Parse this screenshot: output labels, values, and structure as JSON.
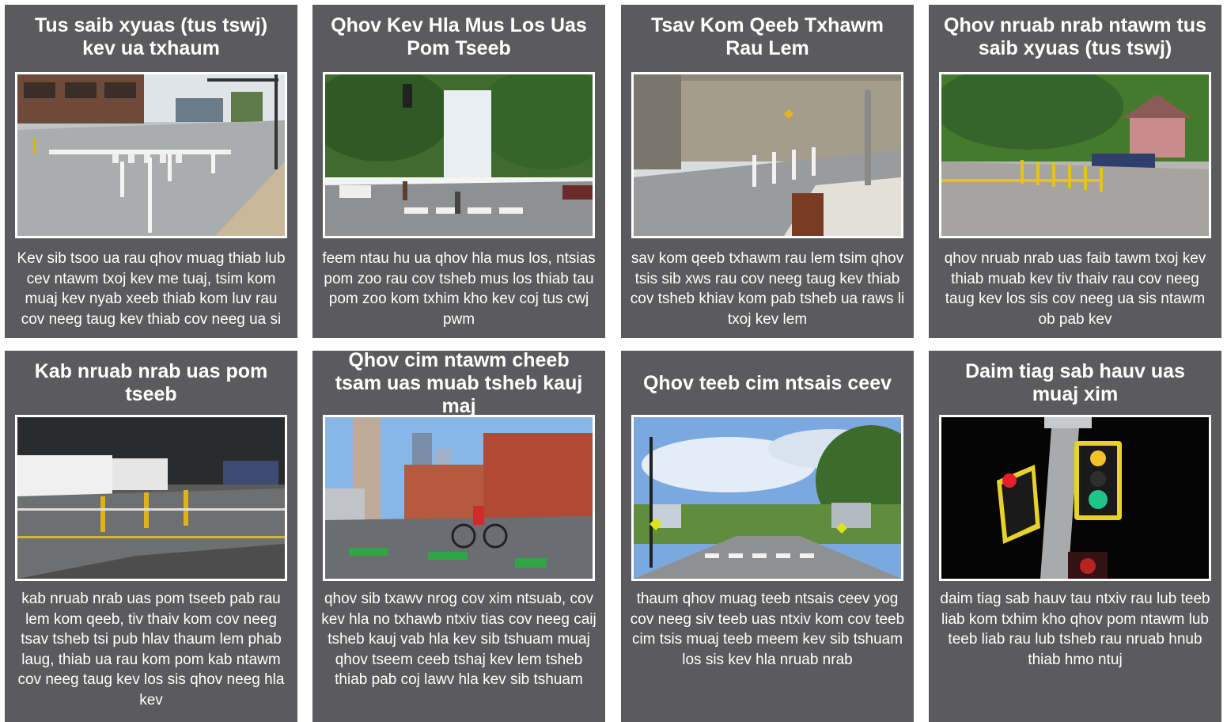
{
  "cards": [
    {
      "title": "Tus saib xyuas (tus tswj) kev ua txhaum",
      "description": "Kev sib tsoo ua rau qhov muag thiab lub cev ntawm txoj kev me tuaj, tsim kom muaj kev nyab xeeb thiab kom luv rau cov neeg taug kev thiab cov neeg ua si",
      "image_alt": "intersection-with-white-bollards-photo"
    },
    {
      "title": "Qhov Kev Hla Mus Los Uas Pom Tseeb",
      "description": "feem ntau hu ua qhov hla mus los, ntsias pom zoo rau cov tsheb mus los thiab tau pom zoo kom txhim kho kev coj tus cwj pwm",
      "image_alt": "pedestrians-crossing-street-photo"
    },
    {
      "title": "Tsav Kom Qeeb Txhawm Rau Lem",
      "description": "sav kom qeeb txhawm rau lem tsim qhov tsis sib xws rau cov neeg taug kev thiab cov tsheb khiav kom pab tsheb ua raws li txoj kev lem",
      "image_alt": "curb-extension-turn-photo"
    },
    {
      "title": "Qhov nruab nrab ntawm tus saib xyuas (tus tswj)",
      "description": "qhov nruab nrab uas faib tawm txoj kev thiab muab kev tiv thaiv rau cov neeg taug kev los sis cov neeg ua sis ntawm ob pab kev",
      "image_alt": "yellow-bollard-median-photo"
    },
    {
      "title": "Kab nruab nrab uas pom tseeb",
      "description": "kab nruab nrab uas pom tseeb pab rau lem kom qeeb, tiv thaiv kom cov neeg tsav tsheb tsi pub hlav thaum lem phab laug, thiab ua rau kom pom kab ntawm cov neeg taug kev los sis qhov neeg hla kev",
      "image_alt": "hardened-centerline-photo"
    },
    {
      "title": "Qhov cim ntawm cheeb tsam uas muab tsheb kauj maj",
      "description": "qhov sib txawv nrog cov xim ntsuab, cov kev hla no txhawb ntxiv tias cov neeg caij tsheb kauj vab hla kev sib tshuam muaj qhov tseem ceeb tshaj kev lem tsheb thiab pab coj lawv hla kev sib tshuam",
      "image_alt": "green-bike-lane-cyclist-photo"
    },
    {
      "title": "Qhov teeb cim ntsais ceev",
      "description": "thaum qhov muag teeb ntsais ceev yog cov neeg siv teeb uas ntxiv kom cov teeb cim tsis muaj teeb meem kev sib tshuam los sis kev hla nruab nrab",
      "image_alt": "flashing-beacon-crosswalk-photo"
    },
    {
      "title": "Daim tiag sab hauv uas muaj xim",
      "description": "daim tiag sab hauv tau ntxiv rau lub teeb liab kom txhim kho qhov pom ntawm lub teeb liab rau lub tsheb rau nruab hnub thiab hmo ntuj",
      "image_alt": "traffic-signal-backplate-photo"
    }
  ]
}
